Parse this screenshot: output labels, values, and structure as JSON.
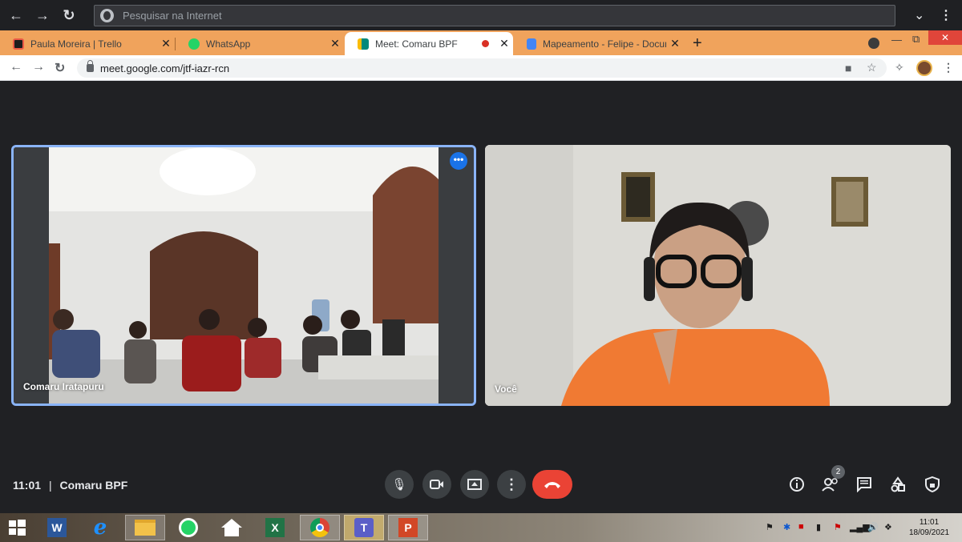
{
  "browser_top": {
    "search_placeholder": "Pesquisar na Internet"
  },
  "tabs": [
    {
      "title": "Paula Moreira | Trello",
      "color": "#0079bf"
    },
    {
      "title": "WhatsApp",
      "color": "#25d366"
    },
    {
      "title": "Meet: Comaru BPF",
      "color": "#00897b"
    },
    {
      "title": "Mapeamento - Felipe - Documen",
      "color": "#4285f4"
    }
  ],
  "address": {
    "url": "meet.google.com/jtf-iazr-rcn"
  },
  "meet": {
    "tiles": [
      {
        "name": "Comaru Iratapuru"
      },
      {
        "name": "Você"
      }
    ],
    "time": "11:01",
    "separator": "|",
    "meeting_name": "Comaru BPF",
    "participants_count": "2",
    "accent": "#8ab4f8",
    "hangup_color": "#ea4335"
  },
  "taskbar": {
    "apps": [
      "start-icon",
      "word-icon",
      "ie-icon",
      "file-explorer-icon",
      "whatsapp-icon",
      "home-icon",
      "excel-icon",
      "chrome-icon",
      "teams-icon",
      "powerpoint-icon"
    ],
    "clock_time": "11:01",
    "clock_date": "18/09/2021"
  }
}
